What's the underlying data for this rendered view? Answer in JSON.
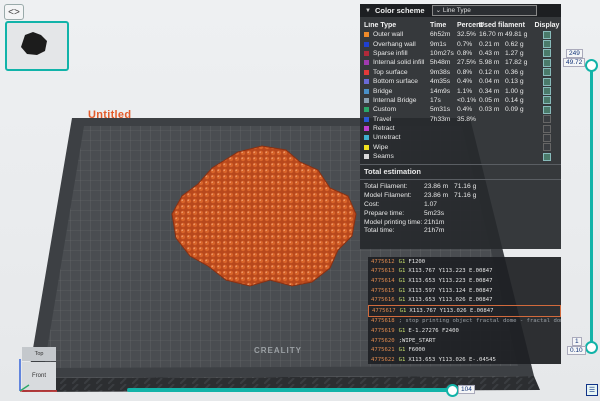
{
  "topbar": {
    "toggle_glyph": "<>"
  },
  "bed": {
    "title": "Untitled",
    "brand": "CREALITY"
  },
  "color_panel": {
    "title": "Color scheme",
    "scheme_value": "Line Type",
    "columns": [
      "Line Type",
      "Time",
      "Percent",
      "Used filament",
      "Display"
    ],
    "rows": [
      {
        "name": "Outer wall",
        "time": "6h52m",
        "pct": "32.5%",
        "len": "16.70 m",
        "w": "49.81 g",
        "color": "#ef8a2a",
        "on": true
      },
      {
        "name": "Overhang wall",
        "time": "9m1s",
        "pct": "0.7%",
        "len": "0.21 m",
        "w": "0.62 g",
        "color": "#2040d0",
        "on": true
      },
      {
        "name": "Sparse infill",
        "time": "10m27s",
        "pct": "0.8%",
        "len": "0.43 m",
        "w": "1.27 g",
        "color": "#b02a3a",
        "on": true
      },
      {
        "name": "Internal solid infill",
        "time": "5h48m",
        "pct": "27.5%",
        "len": "5.98 m",
        "w": "17.82 g",
        "color": "#a03ab0",
        "on": true
      },
      {
        "name": "Top surface",
        "time": "9m38s",
        "pct": "0.8%",
        "len": "0.12 m",
        "w": "0.36 g",
        "color": "#e23a3a",
        "on": true
      },
      {
        "name": "Bottom surface",
        "time": "4m35s",
        "pct": "0.4%",
        "len": "0.04 m",
        "w": "0.13 g",
        "color": "#6a6ad8",
        "on": true
      },
      {
        "name": "Bridge",
        "time": "14m9s",
        "pct": "1.1%",
        "len": "0.34 m",
        "w": "1.00 g",
        "color": "#4a90c8",
        "on": true
      },
      {
        "name": "Internal Bridge",
        "time": "17s",
        "pct": "<0.1%",
        "len": "0.05 m",
        "w": "0.14 g",
        "color": "#8aa0b0",
        "on": true
      },
      {
        "name": "Custom",
        "time": "5m31s",
        "pct": "0.4%",
        "len": "0.03 m",
        "w": "0.09 g",
        "color": "#2aa86a",
        "on": true
      },
      {
        "name": "Travel",
        "time": "7h33m",
        "pct": "35.8%",
        "len": "",
        "w": "",
        "color": "#2a5ad8",
        "on": false
      },
      {
        "name": "Retract",
        "time": "",
        "pct": "",
        "len": "",
        "w": "",
        "color": "#c040d0",
        "on": false
      },
      {
        "name": "Unretract",
        "time": "",
        "pct": "",
        "len": "",
        "w": "",
        "color": "#40b0d0",
        "on": false
      },
      {
        "name": "Wipe",
        "time": "",
        "pct": "",
        "len": "",
        "w": "",
        "color": "#f0e020",
        "on": false
      },
      {
        "name": "Seams",
        "time": "",
        "pct": "",
        "len": "",
        "w": "",
        "color": "#d8d8d8",
        "on": true
      }
    ],
    "estimation": {
      "title": "Total estimation",
      "rows": [
        {
          "label": "Total Filament:",
          "v1": "23.86 m",
          "v2": "71.16 g"
        },
        {
          "label": "Model Filament:",
          "v1": "23.86 m",
          "v2": "71.16 g"
        },
        {
          "label": "Cost:",
          "v1": "1.07",
          "v2": ""
        },
        {
          "label": "Prepare time:",
          "v1": "5m23s",
          "v2": ""
        },
        {
          "label": "Model printing time:",
          "v1": "21h1m",
          "v2": ""
        },
        {
          "label": "Total time:",
          "v1": "21h7m",
          "v2": ""
        }
      ]
    }
  },
  "gcode": [
    {
      "num": "4775612",
      "cmd": "G1",
      "text": "F1200",
      "sel": false,
      "dim": false
    },
    {
      "num": "4775613",
      "cmd": "G1",
      "text": "X113.767 Y113.223 E.00847",
      "sel": false,
      "dim": false
    },
    {
      "num": "4775614",
      "cmd": "G1",
      "text": "X113.653 Y113.223 E.00847",
      "sel": false,
      "dim": false
    },
    {
      "num": "4775615",
      "cmd": "G1",
      "text": "X113.597 Y113.124 E.00847",
      "sel": false,
      "dim": false
    },
    {
      "num": "4775616",
      "cmd": "G1",
      "text": "X113.653 Y113.026 E.00847",
      "sel": false,
      "dim": false
    },
    {
      "num": "4775617",
      "cmd": "G1",
      "text": "X113.767 Y113.026 E.00847",
      "sel": true,
      "dim": false
    },
    {
      "num": "4775618",
      "cmd": "",
      "text": "; stop printing object fractal dome - fractal dome.s...",
      "sel": false,
      "dim": true
    },
    {
      "num": "4775619",
      "cmd": "G1",
      "text": "E-1.27276 F2400",
      "sel": false,
      "dim": false
    },
    {
      "num": "4775620",
      "cmd": "",
      "text": ";WIPE_START",
      "sel": false,
      "dim": false
    },
    {
      "num": "4775621",
      "cmd": "G1",
      "text": "F6000",
      "sel": false,
      "dim": false
    },
    {
      "num": "4775622",
      "cmd": "G1",
      "text": "X113.653 Y113.026 E-.04545",
      "sel": false,
      "dim": false
    }
  ],
  "vslider": {
    "top_a": "249",
    "top_b": "49.72",
    "bot_a": "1",
    "bot_b": "0.10"
  },
  "hslider": {
    "value": "104"
  },
  "cube": {
    "top": "Top",
    "front": "Front"
  }
}
